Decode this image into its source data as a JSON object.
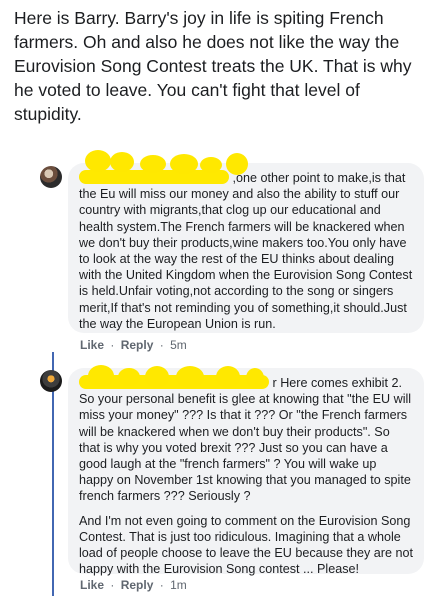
{
  "post": {
    "text": "Here is Barry. Barry's joy in life is spiting French farmers. Oh and also he does not like the way the Eurovision Song Contest treats the UK. That is why he voted to leave. You can't fight that level  of stupidity."
  },
  "comments": [
    {
      "text": ",one other point to make,is that the Eu will miss our money and also the ability to stuff our country with migrants,that clog up our educational and health system.The French farmers will be knackered when we don't buy their products,wine makers too.You only have to look at the way the rest of the EU thinks about dealing with the United Kingdom when the Eurovision Song Contest is held.Unfair voting,not according to the song or singers merit,If that's not reminding you of something,it should.Just the way the European Union is run.",
      "like": "Like",
      "reply": "Reply",
      "time": "5m"
    },
    {
      "text_p1": "r Here comes exhibit 2. So your personal benefit is glee at knowing that \"the EU will miss your money\" ??? Is that it ??? Or \"the French farmers will be knackered when we don't buy their products\". So that is why you voted brexit ??? Just so you can have a good laugh at the \"french farmers\" ? You will wake up happy on November 1st knowing that you managed to spite french farmers ??? Seriously ?",
      "text_p2": "And I'm not even going to comment on the Eurovision Song Contest. That is just too ridiculous. Imagining that a whole load of people choose to leave the EU because they are not happy with the Eurovision Song contest ... Please!",
      "like": "Like",
      "reply": "Reply",
      "time": "1m"
    }
  ],
  "separator": "·",
  "colors": {
    "bubble": "#f2f3f5",
    "thread_line": "#4267b2",
    "redaction": "#ffe800"
  }
}
